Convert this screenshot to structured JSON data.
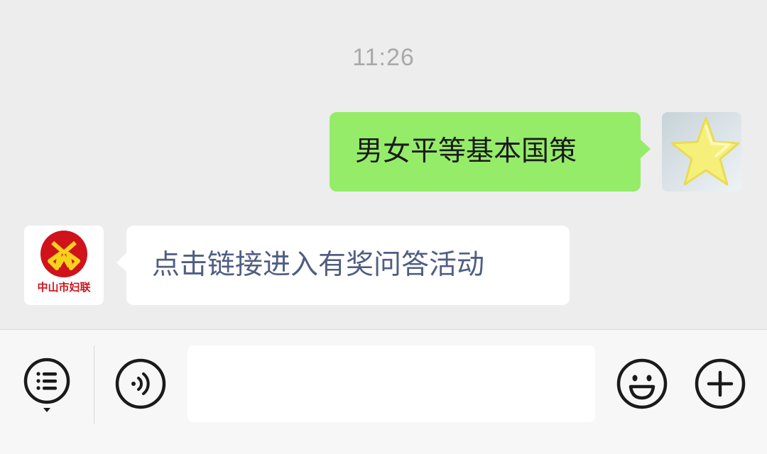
{
  "chat": {
    "timestamp": "11:26",
    "messages": [
      {
        "direction": "outgoing",
        "text": "男女平等基本国策"
      },
      {
        "direction": "incoming",
        "text": "点击链接进入有奖问答活动"
      }
    ],
    "sender_avatar_label": "中山市妇联"
  },
  "input_bar": {
    "text_value": "",
    "icons": [
      "menu-list-icon",
      "voice-icon",
      "emoji-icon",
      "add-icon"
    ]
  },
  "colors": {
    "background": "#ededed",
    "outgoing_bubble": "#95ec69",
    "incoming_bubble": "#ffffff",
    "incoming_text": "#4f5e82",
    "timestamp": "#a9a9a9",
    "logo_red": "#d0121b",
    "logo_yellow": "#f7d21c"
  }
}
